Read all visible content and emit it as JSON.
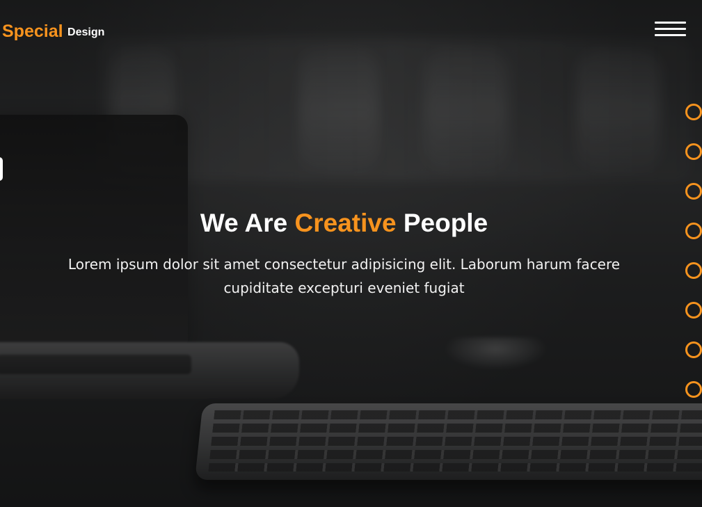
{
  "brand": {
    "name": "Special",
    "suffix": "Design",
    "accent_color": "#f7931e"
  },
  "header": {
    "menu_icon": "hamburger-menu-icon"
  },
  "hero": {
    "title_prefix": "We Are",
    "title_accent": "Creative",
    "title_suffix": "People",
    "description": "Lorem ipsum dolor sit amet consectetur adipisicing elit. Laborum harum facere cupiditate excepturi eveniet fugiat",
    "background": "blurred laptop and keyboard photo"
  },
  "pagination": {
    "count": 8,
    "bullet_color": "#f7931e"
  },
  "side_tab": {
    "icon": "settings-tab-icon"
  }
}
